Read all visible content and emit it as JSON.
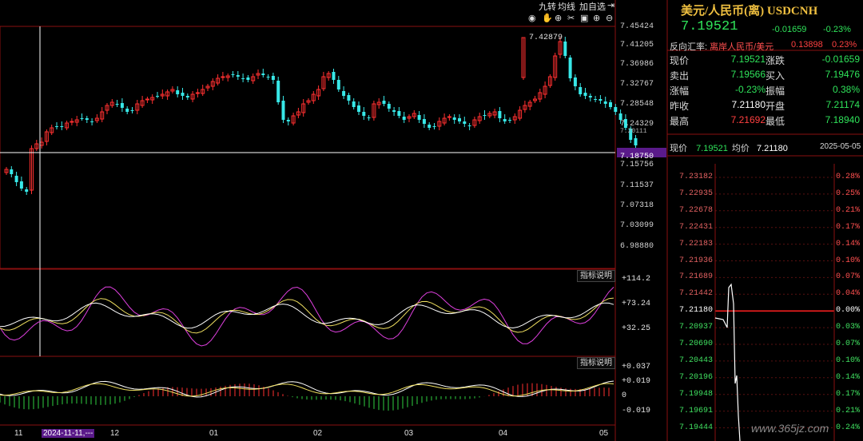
{
  "toolbar": {
    "nine_turn": "九转",
    "ma_line": "均线",
    "add_watch": "加自选"
  },
  "main_chart": {
    "price_ticks": [
      "7.45424",
      "7.41205",
      "7.36986",
      "7.32767",
      "7.28548",
      "7.24329",
      "7.20111",
      "7.15756",
      "7.11537",
      "7.07318",
      "7.03099",
      "6.98880"
    ],
    "current_price_marker": "7.18750",
    "peak_label": "7.42879",
    "indicator_help_1": "指标说明",
    "indicator_help_2": "指标说明",
    "kdj_ticks": [
      "+114.2",
      "+73.24",
      "+32.25"
    ],
    "macd_ticks": [
      "+0.037",
      "+0.019",
      "0",
      "-0.019"
    ],
    "date_ticks": [
      "11",
      "2024-11-11,---",
      "12",
      "01",
      "02",
      "03",
      "04",
      "05"
    ],
    "colors": {
      "up": "#ff3030",
      "down": "#38e8e8",
      "line_white": "#ffffff",
      "line_yellow": "#f0e060",
      "line_magenta": "#e040e0",
      "crosshair": "#ffffff"
    }
  },
  "quote_panel": {
    "title": "美元/人民币(离) USDCNH",
    "price": "7.19521",
    "change": "-0.01659",
    "change_pct": "-0.23%",
    "reverse_label": "反向汇率:",
    "reverse_name": "离岸人民币/美元",
    "reverse_value": "0.13898",
    "reverse_pct": "0.23%",
    "rows": [
      {
        "l1": "现价",
        "v1": "7.19521",
        "c1": "green",
        "l2": "涨跌",
        "v2": "-0.01659",
        "c2": "green"
      },
      {
        "l1": "卖出",
        "v1": "7.19566",
        "c1": "green",
        "l2": "买入",
        "v2": "7.19476",
        "c2": "green"
      },
      {
        "l1": "涨幅",
        "v1": "-0.23%",
        "c1": "green",
        "l2": "振幅",
        "v2": "0.38%",
        "c2": "green"
      },
      {
        "l1": "昨收",
        "v1": "7.21180",
        "c1": "white",
        "l2": "开盘",
        "v2": "7.21174",
        "c2": "green"
      },
      {
        "l1": "最高",
        "v1": "7.21692",
        "c1": "red",
        "l2": "最低",
        "v2": "7.18940",
        "c2": "green"
      }
    ]
  },
  "intraday": {
    "now_label": "现价",
    "now_value": "7.19521",
    "avg_label": "均价",
    "avg_value": "7.21180",
    "date": "2025-05-05",
    "left_ticks": [
      "7.23182",
      "7.22935",
      "7.22678",
      "7.22431",
      "7.22183",
      "7.21936",
      "7.21689",
      "7.21442",
      "7.21180",
      "7.20937",
      "7.20690",
      "7.20443",
      "7.20196",
      "7.19948",
      "7.19691",
      "7.19444"
    ],
    "right_ticks": [
      "0.28%",
      "0.25%",
      "0.21%",
      "0.17%",
      "0.14%",
      "0.10%",
      "0.07%",
      "0.04%",
      "0.00%",
      "0.03%",
      "0.07%",
      "0.10%",
      "0.14%",
      "0.17%",
      "0.21%",
      "0.24%"
    ]
  },
  "watermark": "www.365jz.com"
}
